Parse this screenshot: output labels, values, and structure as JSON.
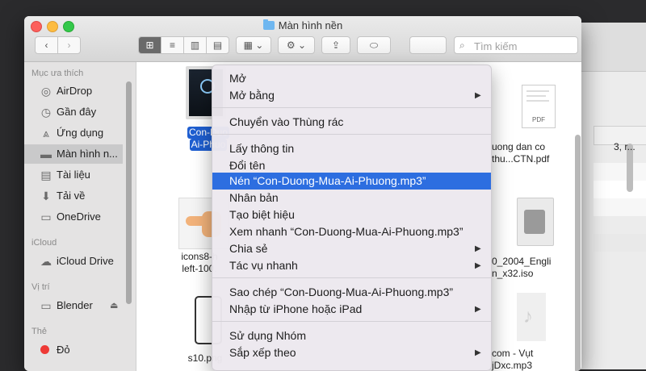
{
  "window": {
    "title": "Màn hình nền"
  },
  "toolbar": {
    "back_label": "‹",
    "forward_label": "›",
    "view_icons": [
      "⊞",
      "≡",
      "▥",
      "▤"
    ],
    "group_label": "▦ ⌄",
    "action_label": "⚙ ⌄",
    "share_label": "⇪",
    "tag_label": "⬭",
    "search_placeholder": "Tìm kiếm"
  },
  "sidebar": {
    "sections": [
      {
        "title": "Mục ưa thích",
        "items": [
          {
            "label": "AirDrop",
            "icon": "airdrop-icon"
          },
          {
            "label": "Gần đây",
            "icon": "clock-icon"
          },
          {
            "label": "Ứng dụng",
            "icon": "applications-icon"
          },
          {
            "label": "Màn hình n...",
            "icon": "desktop-icon",
            "selected": true
          },
          {
            "label": "Tài liệu",
            "icon": "document-icon"
          },
          {
            "label": "Tải về",
            "icon": "download-icon"
          },
          {
            "label": "OneDrive",
            "icon": "folder-icon"
          }
        ]
      },
      {
        "title": "iCloud",
        "items": [
          {
            "label": "iCloud Drive",
            "icon": "cloud-icon"
          }
        ]
      },
      {
        "title": "Vị trí",
        "items": [
          {
            "label": "Blender",
            "icon": "drive-icon"
          }
        ]
      },
      {
        "title": "Thẻ",
        "items": [
          {
            "label": "Đỏ",
            "icon": "red-tag-icon",
            "color": "#ee3a36"
          }
        ]
      }
    ]
  },
  "files": [
    {
      "name_line1": "Con-Duo",
      "name_line2": "Ai-Phuo",
      "selected": true
    },
    {
      "name_line1": "uong dan co",
      "name_line2": "thu...CTN.pdf"
    },
    {
      "name_line1": "icons8-h",
      "name_line2": "left-100."
    },
    {
      "name_line1": "0_2004_Engli",
      "name_line2": "n_x32.iso"
    },
    {
      "name_line1": "s10.png",
      "name_line2": ""
    },
    {
      "name_line1": "com - Vụt",
      "name_line2": "jDxc.mp3"
    }
  ],
  "thumb_labels": {
    "pdf": "PDF"
  },
  "background_window": {
    "text": "3, r..."
  },
  "context_menu": {
    "groups": [
      [
        {
          "label": "Mở"
        },
        {
          "label": "Mở bằng",
          "submenu": true
        }
      ],
      [
        {
          "label": "Chuyển vào Thùng rác"
        }
      ],
      [
        {
          "label": "Lấy thông tin"
        },
        {
          "label": "Đổi tên"
        },
        {
          "label": "Nén “Con-Duong-Mua-Ai-Phuong.mp3”",
          "highlighted": true
        },
        {
          "label": "Nhân bản"
        },
        {
          "label": "Tạo biệt hiệu"
        },
        {
          "label": "Xem nhanh “Con-Duong-Mua-Ai-Phuong.mp3”"
        },
        {
          "label": "Chia sẻ",
          "submenu": true
        },
        {
          "label": "Tác vụ nhanh",
          "submenu": true
        }
      ],
      [
        {
          "label": "Sao chép “Con-Duong-Mua-Ai-Phuong.mp3”"
        },
        {
          "label": "Nhập từ iPhone hoặc iPad",
          "submenu": true
        }
      ],
      [
        {
          "label": "Sử dụng Nhóm"
        },
        {
          "label": "Sắp xếp theo",
          "submenu": true
        }
      ]
    ],
    "submenu_arrow": "▶"
  }
}
